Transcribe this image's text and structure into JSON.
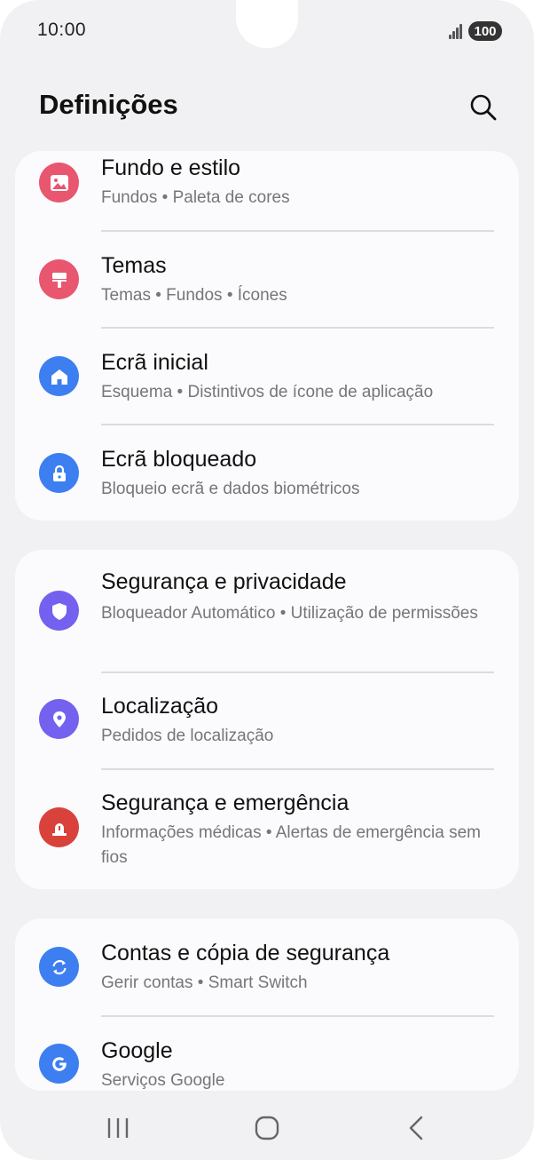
{
  "status_bar": {
    "time": "10:00",
    "battery": "100"
  },
  "header": {
    "title": "Definições"
  },
  "cards": [
    {
      "items": [
        {
          "title": "Fundo e estilo",
          "subtitle": "Fundos  •  Paleta de cores",
          "icon": "image-icon",
          "color": "#e8566f"
        },
        {
          "title": "Temas",
          "subtitle": "Temas  •  Fundos  •  Ícones",
          "icon": "brush-icon",
          "color": "#e8566f"
        },
        {
          "title": "Ecrã inicial",
          "subtitle": "Esquema  •  Distintivos de ícone de aplicação",
          "icon": "home-icon",
          "color": "#3d7ff0"
        },
        {
          "title": "Ecrã bloqueado",
          "subtitle": "Bloqueio ecrã e dados biométricos",
          "icon": "lock-icon",
          "color": "#3d7ff0"
        }
      ]
    },
    {
      "items": [
        {
          "title": "Segurança e privacidade",
          "subtitle": "Bloqueador Automático  •  Utilização de permissões",
          "icon": "shield-icon",
          "color": "#7461f0"
        },
        {
          "title": "Localização",
          "subtitle": "Pedidos de localização",
          "icon": "location-pin-icon",
          "color": "#7461f0"
        },
        {
          "title": "Segurança e emergência",
          "subtitle": "Informações médicas  •  Alertas de emergência sem fios",
          "icon": "emergency-light-icon",
          "color": "#d9423b"
        }
      ]
    },
    {
      "items": [
        {
          "title": "Contas e cópia de segurança",
          "subtitle": "Gerir contas  •  Smart Switch",
          "icon": "sync-icon",
          "color": "#3d7ff0"
        },
        {
          "title": "Google",
          "subtitle": "Serviços Google",
          "icon": "google-icon",
          "color": "#3d7ff0"
        }
      ]
    }
  ],
  "navbar": {
    "recents": "recents-icon",
    "home": "home-button-icon",
    "back": "back-icon"
  }
}
